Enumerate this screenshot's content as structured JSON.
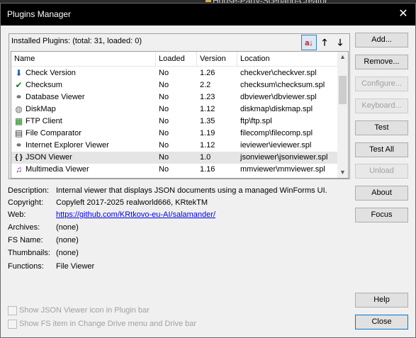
{
  "background": {
    "title": "House-Party-Scenario-Creator"
  },
  "window": {
    "title": "Plugins Manager",
    "close_glyph": "✕"
  },
  "plugins_header": {
    "label": "Installed Plugins: (total: 31, loaded: 0)",
    "sort_button": "a↓",
    "move_up": "🡑",
    "move_down": "🡓"
  },
  "columns": {
    "name": "Name",
    "loaded": "Loaded",
    "version": "Version",
    "location": "Location"
  },
  "plugins": [
    {
      "name": "Check Version",
      "loaded": "No",
      "version": "1.26",
      "location": "checkver\\checkver.spl",
      "icon": "check-version-icon",
      "glyph": "⬇",
      "color": "#1a5fb4"
    },
    {
      "name": "Checksum",
      "loaded": "No",
      "version": "2.2",
      "location": "checksum\\checksum.spl",
      "icon": "checksum-icon",
      "glyph": "✔",
      "color": "#1a7f1a"
    },
    {
      "name": "Database Viewer",
      "loaded": "No",
      "version": "1.23",
      "location": "dbviewer\\dbviewer.spl",
      "icon": "database-viewer-icon",
      "glyph": "⚭",
      "color": "#444444"
    },
    {
      "name": "DiskMap",
      "loaded": "No",
      "version": "1.12",
      "location": "diskmap\\diskmap.spl",
      "icon": "diskmap-icon",
      "glyph": "◍",
      "color": "#6b6b6b"
    },
    {
      "name": "FTP Client",
      "loaded": "No",
      "version": "1.35",
      "location": "ftp\\ftp.spl",
      "icon": "ftp-client-icon",
      "glyph": "▦",
      "color": "#1a7f1a"
    },
    {
      "name": "File Comparator",
      "loaded": "No",
      "version": "1.19",
      "location": "filecomp\\filecomp.spl",
      "icon": "file-comparator-icon",
      "glyph": "▤",
      "color": "#333333"
    },
    {
      "name": "Internet Explorer Viewer",
      "loaded": "No",
      "version": "1.12",
      "location": "ieviewer\\ieviewer.spl",
      "icon": "ie-viewer-icon",
      "glyph": "⚭",
      "color": "#444444"
    },
    {
      "name": "JSON Viewer",
      "loaded": "No",
      "version": "1.0",
      "location": "jsonviewer\\jsonviewer.spl",
      "icon": "json-viewer-icon",
      "glyph": "{ }",
      "color": "#000000"
    },
    {
      "name": "Multimedia Viewer",
      "loaded": "No",
      "version": "1.16",
      "location": "mmviewer\\mmviewer.spl",
      "icon": "multimedia-viewer-icon",
      "glyph": "♫",
      "color": "#7a1fa2"
    }
  ],
  "buttons": {
    "add": "Add...",
    "remove": "Remove...",
    "configure": "Configure...",
    "keyboard": "Keyboard...",
    "test": "Test",
    "test_all": "Test All",
    "unload": "Unload",
    "about": "About",
    "focus": "Focus",
    "help": "Help",
    "close": "Close"
  },
  "details": {
    "description_label": "Description:",
    "description": "Internal viewer that displays JSON documents using a managed WinForms UI.",
    "copyright_label": "Copyright:",
    "copyright": "Copyleft 2017-2025 realworld666, KRtekTM",
    "web_label": "Web:",
    "web": "https://github.com/KRtkovo-eu-AI/salamander/",
    "archives_label": "Archives:",
    "archives": "(none)",
    "fsname_label": "FS Name:",
    "fsname": "(none)",
    "thumbnails_label": "Thumbnails:",
    "thumbnails": "(none)",
    "functions_label": "Functions:",
    "functions": "File Viewer"
  },
  "checkboxes": {
    "show_icon": "Show JSON Viewer icon in Plugin bar",
    "show_fs": "Show FS item in Change Drive menu and Drive bar"
  },
  "scrollbar": {
    "up_glyph": "▲",
    "down_glyph": "▼"
  },
  "selected_index": 7
}
